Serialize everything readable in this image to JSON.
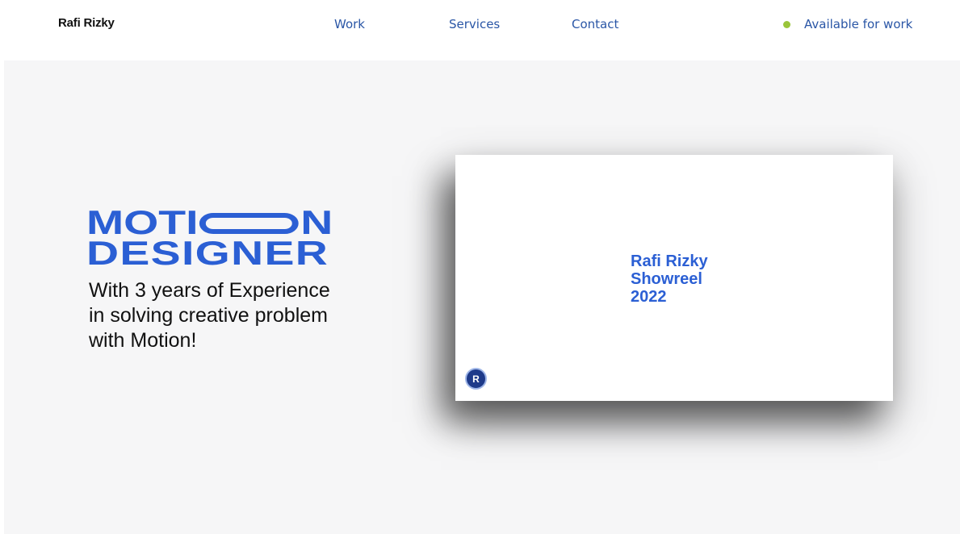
{
  "header": {
    "brand": "Rafi Rizky",
    "nav": [
      {
        "label": "Work"
      },
      {
        "label": "Services"
      },
      {
        "label": "Contact"
      }
    ],
    "status": {
      "label": "Available for work",
      "dot_color": "#9ac53a"
    }
  },
  "hero": {
    "title_line1_start": "MOTI",
    "title_line1_end": "N",
    "title_line2": "DESIGNER",
    "tagline_lines": [
      "With 3 years of Experience",
      "in solving creative problem",
      "with Motion!"
    ],
    "accent_color": "#2b5fd4"
  },
  "video": {
    "title_lines": [
      "Rafi Rizky",
      "Showreel",
      "2022"
    ],
    "avatar_letter": "R"
  }
}
